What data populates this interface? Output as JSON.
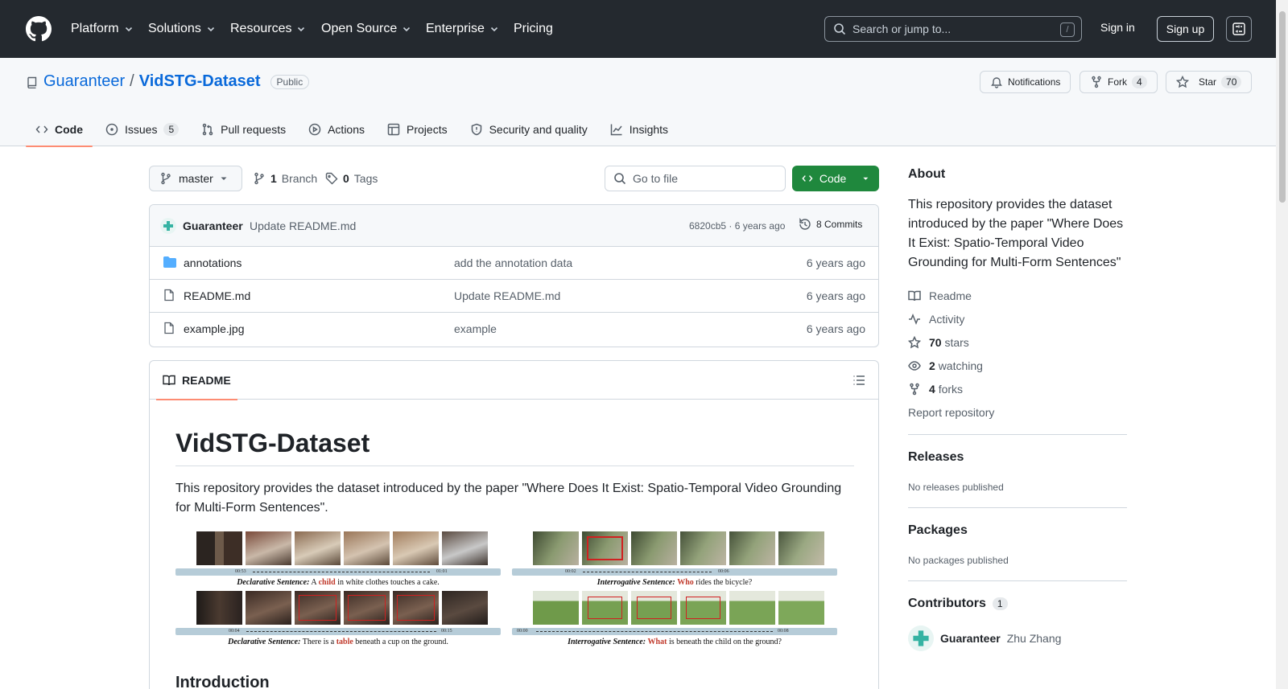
{
  "header": {
    "nav": [
      "Platform",
      "Solutions",
      "Resources",
      "Open Source",
      "Enterprise"
    ],
    "pricing": "Pricing",
    "search_placeholder": "Search or jump to...",
    "search_key": "/",
    "signin": "Sign in",
    "signup": "Sign up"
  },
  "repo": {
    "owner": "Guaranteer",
    "separator": "/",
    "name": "VidSTG-Dataset",
    "visibility": "Public",
    "notifications_label": "Notifications",
    "fork_label": "Fork",
    "fork_count": "4",
    "star_label": "Star",
    "star_count": "70"
  },
  "tabs": [
    {
      "label": "Code"
    },
    {
      "label": "Issues",
      "count": "5"
    },
    {
      "label": "Pull requests"
    },
    {
      "label": "Actions"
    },
    {
      "label": "Projects"
    },
    {
      "label": "Security and quality"
    },
    {
      "label": "Insights"
    }
  ],
  "branchbar": {
    "branch": "master",
    "branches_count": "1",
    "branches_label": "Branch",
    "tags_count": "0",
    "tags_label": "Tags",
    "goto_placeholder": "Go to file",
    "code_label": "Code"
  },
  "latest_commit": {
    "author": "Guaranteer",
    "message": "Update README.md",
    "hash_age": "6820cb5 · 6 years ago",
    "commits_label": "8 Commits"
  },
  "files": [
    {
      "name": "annotations",
      "type": "folder",
      "message": "add the annotation data",
      "age": "6 years ago"
    },
    {
      "name": "README.md",
      "type": "file",
      "message": "Update README.md",
      "age": "6 years ago"
    },
    {
      "name": "example.jpg",
      "type": "file",
      "message": "example",
      "age": "6 years ago"
    }
  ],
  "readme": {
    "tab_label": "README",
    "title": "VidSTG-Dataset",
    "paragraph": "This repository provides the dataset introduced by the paper \"Where Does It Exist: Spatio-Temporal Video Grounding for Multi-Form Sentences\".",
    "figure": {
      "panels": [
        {
          "t_start": "00:53",
          "t_end": "01:01",
          "type": "Declarative Sentence:",
          "pre": "A",
          "hl": "child",
          "post": "in white clothes touches a cake."
        },
        {
          "t_start": "00:02",
          "t_end": "00:06",
          "type": "Interrogative Sentence:",
          "pre": "",
          "hl": "Who",
          "post": "rides the bicycle?"
        },
        {
          "t_start": "00:04",
          "t_end": "00:15",
          "type": "Declarative Sentence:",
          "pre": "There is a",
          "hl": "table",
          "post": "beneath a cup on the ground."
        },
        {
          "t_start": "00:00",
          "t_end": "00:08",
          "type": "Interrogative Sentence:",
          "pre": "",
          "hl": "What",
          "post": "is beneath the child on the ground?"
        }
      ]
    },
    "intro_heading": "Introduction"
  },
  "sidebar": {
    "about_heading": "About",
    "about_text": "This repository provides the dataset introduced by the paper \"Where Does It Exist: Spatio-Temporal Video Grounding for Multi-Form Sentences\"",
    "readme_link": "Readme",
    "activity_link": "Activity",
    "stars_count": "70",
    "stars_label": "stars",
    "watching_count": "2",
    "watching_label": "watching",
    "forks_count": "4",
    "forks_label": "forks",
    "report_link": "Report repository",
    "releases_heading": "Releases",
    "releases_text": "No releases published",
    "packages_heading": "Packages",
    "packages_text": "No packages published",
    "contributors_heading": "Contributors",
    "contributors_count": "1",
    "contributor_login": "Guaranteer",
    "contributor_name": "Zhu Zhang"
  },
  "colors": {
    "header_bg": "#24292f",
    "link": "#0969da",
    "primary_green": "#1f883d",
    "tab_underline": "#fd8c73",
    "highlight_red": "#c0392b"
  }
}
